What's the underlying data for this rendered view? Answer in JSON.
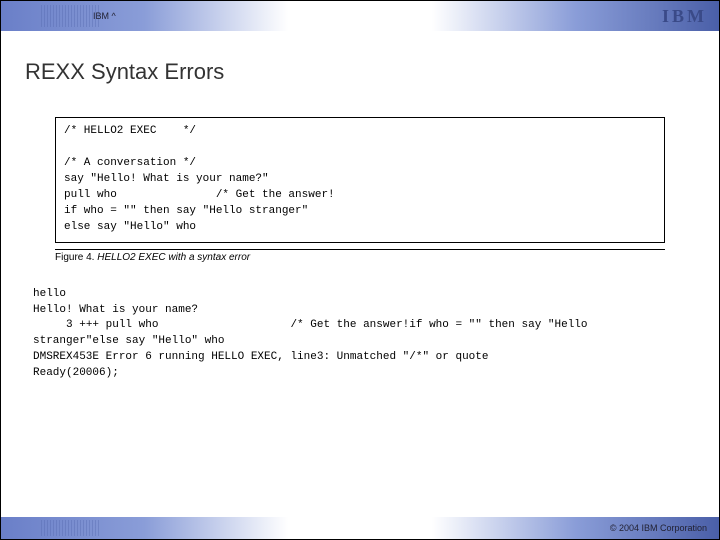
{
  "header": {
    "brand_text": "IBM ^",
    "logo_text": "IBM"
  },
  "title": "REXX Syntax Errors",
  "codebox": {
    "lines": [
      "/* HELLO2 EXEC    */",
      "",
      "/* A conversation */",
      "say \"Hello! What is your name?\"",
      "pull who               /* Get the answer!",
      "if who = \"\" then say \"Hello stranger\"",
      "else say \"Hello\" who"
    ]
  },
  "caption": {
    "label": "Figure 4.",
    "text": "HELLO2 EXEC with a syntax error"
  },
  "output": {
    "lines": [
      "hello",
      "Hello! What is your name?",
      "     3 +++ pull who                    /* Get the answer!if who = \"\" then say \"Hello",
      "stranger\"else say \"Hello\" who",
      "DMSREX453E Error 6 running HELLO EXEC, line3: Unmatched \"/*\" or quote",
      "Ready(20006);"
    ]
  },
  "footer": {
    "copyright": "© 2004 IBM Corporation"
  }
}
